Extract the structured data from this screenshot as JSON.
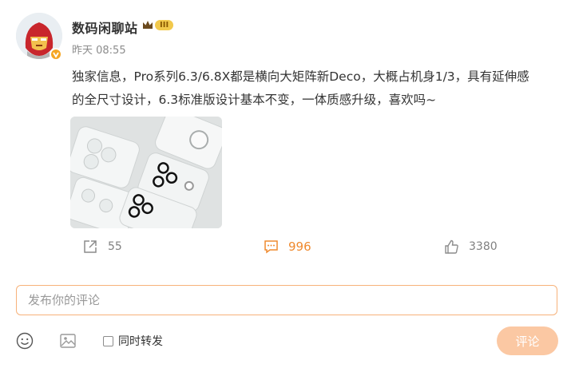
{
  "post": {
    "author": "数码闲聊站",
    "level_badge": "III",
    "timestamp": "昨天 08:55",
    "content_line1": "独家信息，Pro系列6.3/6.8X都是横向大矩阵新Deco，大概占机身1/3，具有延伸感",
    "content_line2": "的全尺寸设计，6.3标准版设计基本不变，一体质感升级，喜欢吗~"
  },
  "actions": {
    "repost_count": "55",
    "comment_count": "996",
    "like_count": "3380"
  },
  "comment_box": {
    "placeholder": "发布你的评论",
    "repost_option_label": "同时转发",
    "submit_label": "评论"
  },
  "icons": {
    "avatar": "iron-man-avatar",
    "verified": "verified-badge-icon",
    "repost": "share-icon",
    "comment": "comment-icon",
    "like": "thumb-up-icon",
    "emoji": "emoji-icon",
    "image": "image-icon"
  },
  "colors": {
    "accent": "#ef8a2f",
    "submit_bg": "#fbc8a3",
    "input_border": "#f7b27a"
  }
}
